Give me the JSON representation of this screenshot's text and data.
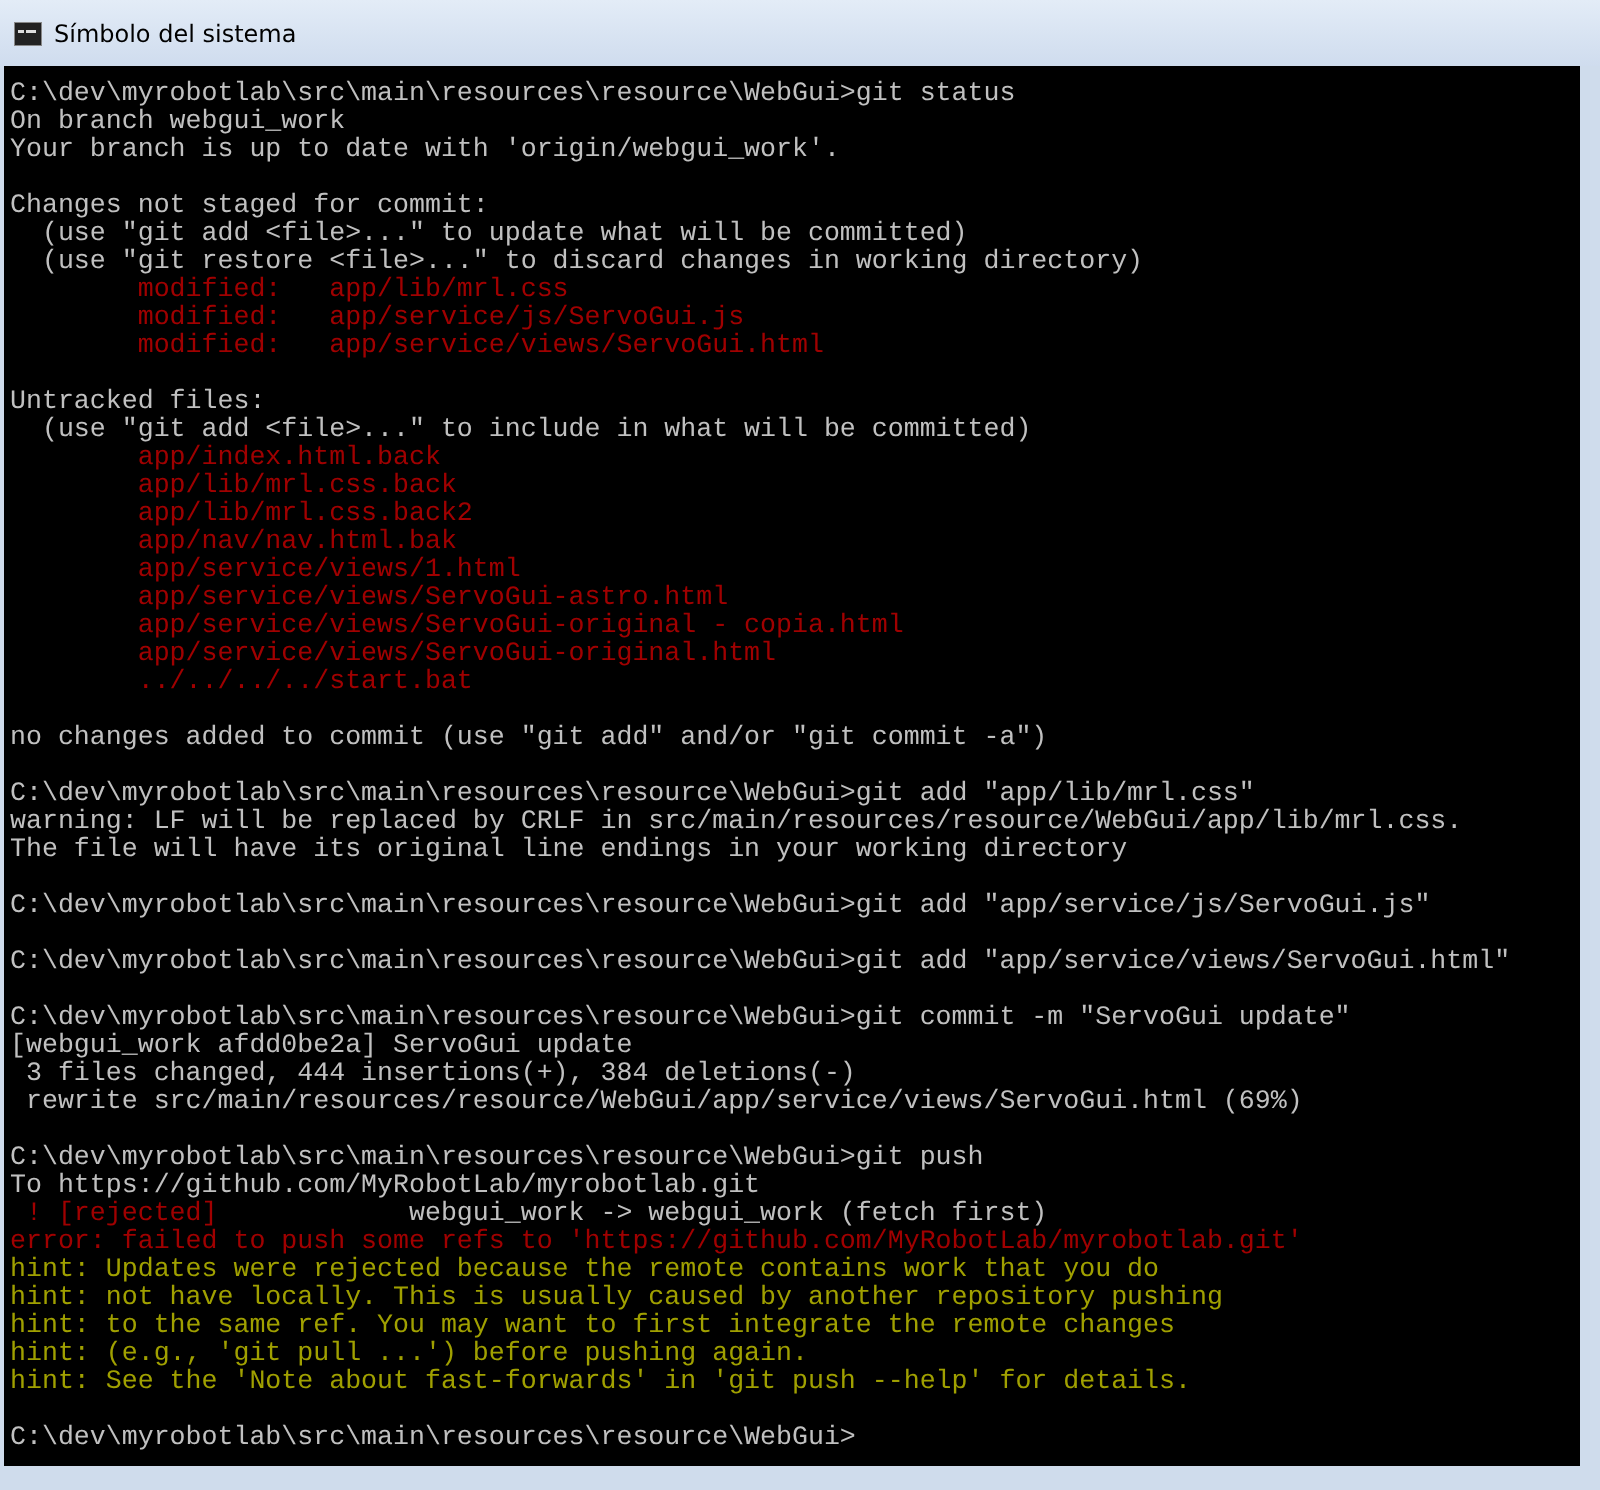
{
  "window": {
    "title": "Símbolo del sistema"
  },
  "console": {
    "lines": [
      {
        "kind": "text",
        "color": "#c0c0c0",
        "text": "C:\\dev\\myrobotlab\\src\\main\\resources\\resource\\WebGui>git status"
      },
      {
        "kind": "text",
        "color": "#c0c0c0",
        "text": "On branch webgui_work"
      },
      {
        "kind": "text",
        "color": "#c0c0c0",
        "text": "Your branch is up to date with 'origin/webgui_work'."
      },
      {
        "kind": "blank"
      },
      {
        "kind": "text",
        "color": "#c0c0c0",
        "text": "Changes not staged for commit:"
      },
      {
        "kind": "text",
        "color": "#c0c0c0",
        "text": "  (use \"git add <file>...\" to update what will be committed)"
      },
      {
        "kind": "text",
        "color": "#c0c0c0",
        "text": "  (use \"git restore <file>...\" to discard changes in working directory)"
      },
      {
        "kind": "text",
        "color": "#a00000",
        "text": "        modified:   app/lib/mrl.css"
      },
      {
        "kind": "text",
        "color": "#a00000",
        "text": "        modified:   app/service/js/ServoGui.js"
      },
      {
        "kind": "text",
        "color": "#a00000",
        "text": "        modified:   app/service/views/ServoGui.html"
      },
      {
        "kind": "blank"
      },
      {
        "kind": "text",
        "color": "#c0c0c0",
        "text": "Untracked files:"
      },
      {
        "kind": "text",
        "color": "#c0c0c0",
        "text": "  (use \"git add <file>...\" to include in what will be committed)"
      },
      {
        "kind": "text",
        "color": "#a00000",
        "text": "        app/index.html.back"
      },
      {
        "kind": "text",
        "color": "#a00000",
        "text": "        app/lib/mrl.css.back"
      },
      {
        "kind": "text",
        "color": "#a00000",
        "text": "        app/lib/mrl.css.back2"
      },
      {
        "kind": "text",
        "color": "#a00000",
        "text": "        app/nav/nav.html.bak"
      },
      {
        "kind": "text",
        "color": "#a00000",
        "text": "        app/service/views/1.html"
      },
      {
        "kind": "text",
        "color": "#a00000",
        "text": "        app/service/views/ServoGui-astro.html"
      },
      {
        "kind": "text",
        "color": "#a00000",
        "text": "        app/service/views/ServoGui-original - copia.html"
      },
      {
        "kind": "text",
        "color": "#a00000",
        "text": "        app/service/views/ServoGui-original.html"
      },
      {
        "kind": "text",
        "color": "#a00000",
        "text": "        ../../../../start.bat"
      },
      {
        "kind": "blank"
      },
      {
        "kind": "text",
        "color": "#c0c0c0",
        "text": "no changes added to commit (use \"git add\" and/or \"git commit -a\")"
      },
      {
        "kind": "blank"
      },
      {
        "kind": "text",
        "color": "#c0c0c0",
        "text": "C:\\dev\\myrobotlab\\src\\main\\resources\\resource\\WebGui>git add \"app/lib/mrl.css\""
      },
      {
        "kind": "text",
        "color": "#c0c0c0",
        "text": "warning: LF will be replaced by CRLF in src/main/resources/resource/WebGui/app/lib/mrl.css."
      },
      {
        "kind": "text",
        "color": "#c0c0c0",
        "text": "The file will have its original line endings in your working directory"
      },
      {
        "kind": "blank"
      },
      {
        "kind": "text",
        "color": "#c0c0c0",
        "text": "C:\\dev\\myrobotlab\\src\\main\\resources\\resource\\WebGui>git add \"app/service/js/ServoGui.js\""
      },
      {
        "kind": "blank"
      },
      {
        "kind": "text",
        "color": "#c0c0c0",
        "text": "C:\\dev\\myrobotlab\\src\\main\\resources\\resource\\WebGui>git add \"app/service/views/ServoGui.html\""
      },
      {
        "kind": "blank"
      },
      {
        "kind": "text",
        "color": "#c0c0c0",
        "text": "C:\\dev\\myrobotlab\\src\\main\\resources\\resource\\WebGui>git commit -m \"ServoGui update\""
      },
      {
        "kind": "text",
        "color": "#c0c0c0",
        "text": "[webgui_work afdd0be2a] ServoGui update"
      },
      {
        "kind": "text",
        "color": "#c0c0c0",
        "text": " 3 files changed, 444 insertions(+), 384 deletions(-)"
      },
      {
        "kind": "text",
        "color": "#c0c0c0",
        "text": " rewrite src/main/resources/resource/WebGui/app/service/views/ServoGui.html (69%)"
      },
      {
        "kind": "blank"
      },
      {
        "kind": "text",
        "color": "#c0c0c0",
        "text": "C:\\dev\\myrobotlab\\src\\main\\resources\\resource\\WebGui>git push"
      },
      {
        "kind": "text",
        "color": "#c0c0c0",
        "text": "To https://github.com/MyRobotLab/myrobotlab.git"
      },
      {
        "kind": "mixed",
        "parts": [
          {
            "color": "#a00000",
            "text": " ! [rejected]"
          },
          {
            "color": "#c0c0c0",
            "text": "            webgui_work -> webgui_work (fetch first)"
          }
        ]
      },
      {
        "kind": "text",
        "color": "#a00000",
        "text": "error: failed to push some refs to 'https://github.com/MyRobotLab/myrobotlab.git'"
      },
      {
        "kind": "text",
        "color": "#a0a000",
        "text": "hint: Updates were rejected because the remote contains work that you do"
      },
      {
        "kind": "text",
        "color": "#a0a000",
        "text": "hint: not have locally. This is usually caused by another repository pushing"
      },
      {
        "kind": "text",
        "color": "#a0a000",
        "text": "hint: to the same ref. You may want to first integrate the remote changes"
      },
      {
        "kind": "text",
        "color": "#a0a000",
        "text": "hint: (e.g., 'git pull ...') before pushing again."
      },
      {
        "kind": "text",
        "color": "#a0a000",
        "text": "hint: See the 'Note about fast-forwards' in 'git push --help' for details."
      },
      {
        "kind": "blank"
      },
      {
        "kind": "text",
        "color": "#c0c0c0",
        "text": "C:\\dev\\myrobotlab\\src\\main\\resources\\resource\\WebGui>"
      }
    ]
  }
}
